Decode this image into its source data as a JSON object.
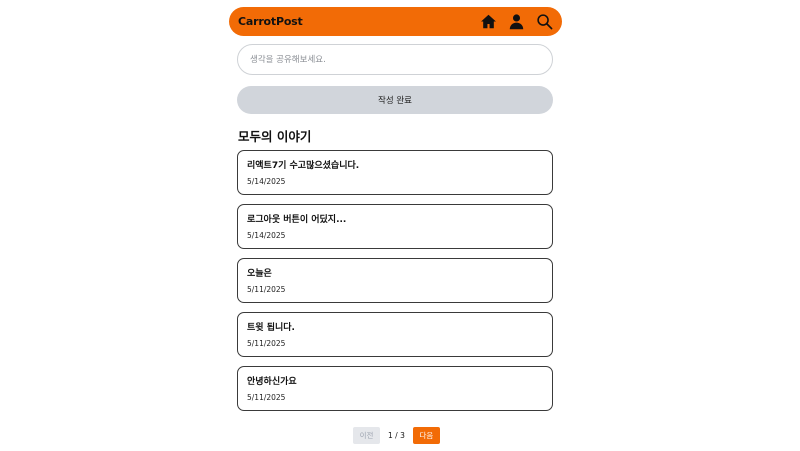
{
  "header": {
    "logo": "CarrotPost",
    "icons": [
      "home-icon",
      "user-icon",
      "search-icon"
    ],
    "accent_color": "#f26b06"
  },
  "composer": {
    "placeholder": "생각을 공유해보세요.",
    "value": "",
    "submit_label": "작성 완료"
  },
  "feed": {
    "title": "모두의 이야기",
    "posts": [
      {
        "title": "리액트7기 수고많으셨습니다.",
        "date": "5/14/2025"
      },
      {
        "title": "로그아웃 버튼이 어딨지...",
        "date": "5/14/2025"
      },
      {
        "title": "오늘은",
        "date": "5/11/2025"
      },
      {
        "title": "트윗 됩니다.",
        "date": "5/11/2025"
      },
      {
        "title": "안녕하신가요",
        "date": "5/11/2025"
      }
    ]
  },
  "pagination": {
    "prev_label": "이전",
    "next_label": "다음",
    "page_info": "1 / 3",
    "current_page": 1,
    "total_pages": 3
  }
}
